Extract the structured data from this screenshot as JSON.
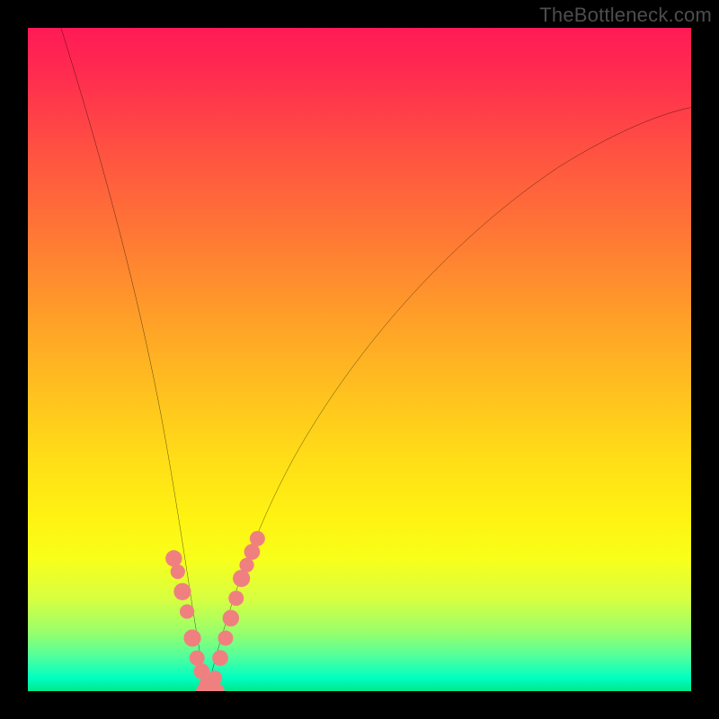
{
  "watermark": "TheBottleneck.com",
  "colors": {
    "frame": "#000000",
    "curve": "#000000",
    "marker": "#f08080",
    "gradient_stops": [
      "#ff1a56",
      "#ff2f4e",
      "#ff5640",
      "#ff7a34",
      "#ffa028",
      "#ffc41e",
      "#ffe016",
      "#fff312",
      "#f8ff1a",
      "#d8ff40",
      "#9aff6a",
      "#4cffa0",
      "#00ffc0",
      "#00e68c"
    ]
  },
  "chart_data": {
    "type": "line",
    "title": "",
    "xlabel": "",
    "ylabel": "",
    "xlim": [
      0,
      100
    ],
    "ylim": [
      0,
      100
    ],
    "grid": false,
    "series": [
      {
        "name": "left-branch",
        "x": [
          5,
          7,
          9,
          11,
          13,
          15,
          17,
          19,
          21,
          23,
          24.5,
          26,
          27
        ],
        "y": [
          100,
          91,
          82,
          73,
          64,
          55,
          46,
          37,
          27,
          15,
          8,
          2,
          0
        ]
      },
      {
        "name": "right-branch",
        "x": [
          27,
          29,
          31,
          33,
          36,
          40,
          45,
          50,
          56,
          62,
          70,
          80,
          90,
          100
        ],
        "y": [
          0,
          6,
          12,
          18,
          26,
          35,
          45,
          53,
          60,
          66,
          73,
          80,
          85,
          88
        ]
      }
    ],
    "markers": [
      {
        "name": "left-cluster",
        "x": [
          22,
          22.6,
          23.3,
          24,
          24.8,
          25.5,
          26.2,
          26.9,
          27.5
        ],
        "y": [
          20,
          18,
          15,
          12,
          8,
          5,
          3,
          1,
          0
        ]
      },
      {
        "name": "right-cluster",
        "x": [
          28.2,
          29,
          29.8,
          30.6,
          31.4,
          32.2,
          33,
          33.8,
          34.6
        ],
        "y": [
          2,
          5,
          8,
          11,
          14,
          17,
          19,
          21,
          23
        ]
      },
      {
        "name": "bottom-fill",
        "x": [
          26.5,
          27,
          27.5,
          28,
          28.5
        ],
        "y": [
          0,
          0,
          0,
          0,
          0
        ]
      }
    ]
  }
}
